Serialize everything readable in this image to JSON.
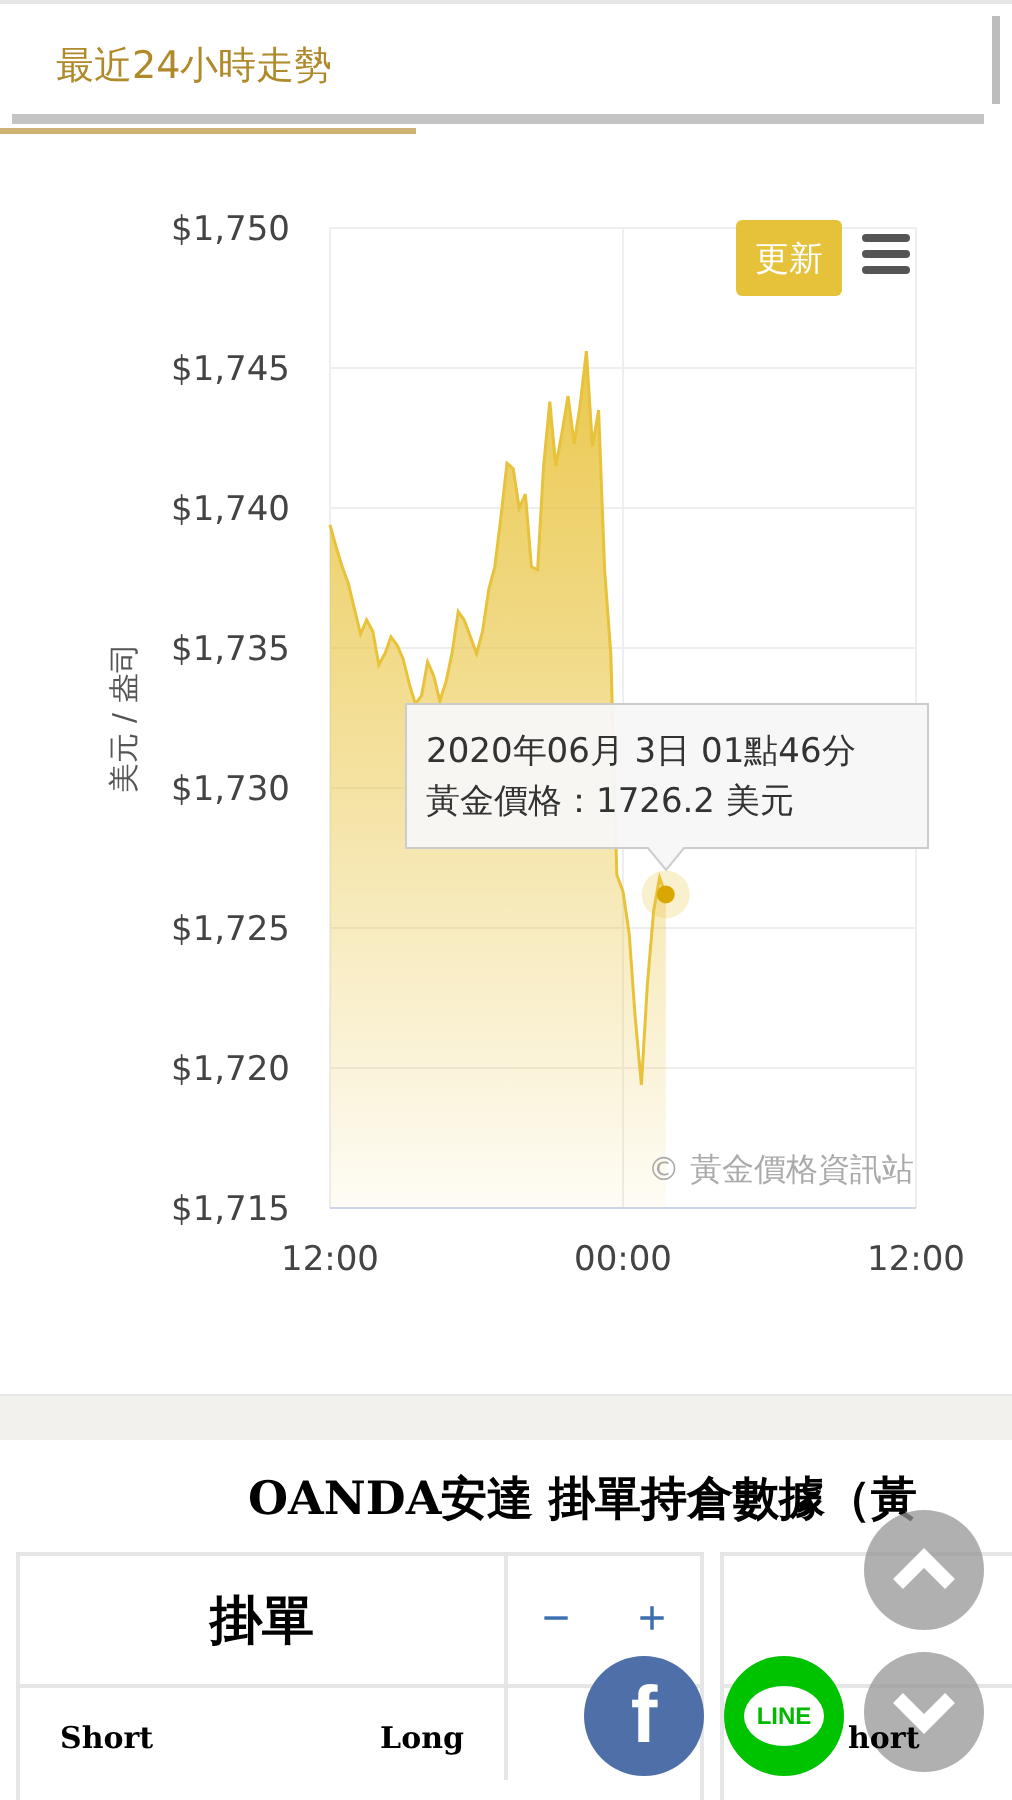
{
  "tabs": [
    {
      "label": "最近24小時走勢",
      "selected": true
    }
  ],
  "chart": {
    "refresh_button": "更新",
    "credit": "© 黃金價格資訊站",
    "tooltip": {
      "lines": [
        "2020年06月 3日 01點46分",
        "黃金價格：1726.2 美元"
      ]
    },
    "chart_data": {
      "type": "area",
      "grid": true,
      "ylabel": "美元 / 盎司",
      "categories": [
        "12:00",
        null,
        null,
        null,
        null,
        null,
        null,
        null,
        null,
        null,
        null,
        null,
        null,
        null,
        null,
        null,
        null,
        null,
        null,
        null,
        null,
        null,
        null,
        null,
        null,
        null,
        null,
        null,
        null,
        null,
        null,
        null,
        null,
        null,
        null,
        null,
        null,
        null,
        null,
        null,
        null,
        null,
        null,
        null,
        null,
        null,
        null,
        null,
        "00:00",
        null,
        null,
        null,
        null,
        null,
        null,
        null,
        null,
        null,
        null,
        null,
        null,
        null,
        null,
        null,
        null,
        null,
        null,
        null,
        null,
        null,
        null,
        null,
        null,
        null,
        null,
        null,
        null,
        null,
        null,
        null,
        null,
        null,
        null,
        null,
        null,
        null,
        null,
        null,
        null,
        null,
        null,
        null,
        null,
        null,
        null,
        null,
        "12:00"
      ],
      "series": [
        {
          "color": "#e8c23a",
          "values": [
            1739.4,
            1738.6,
            1737.9,
            1737.3,
            1736.4,
            1735.5,
            1736.0,
            1735.6,
            1734.4,
            1734.8,
            1735.4,
            1735.1,
            1734.6,
            1733.7,
            1733.0,
            1733.3,
            1734.5,
            1734.0,
            1733.1,
            1733.8,
            1734.8,
            1736.3,
            1736.0,
            1735.4,
            1734.8,
            1735.6,
            1737.1,
            1737.9,
            1739.7,
            1741.6,
            1741.4,
            1740.0,
            1740.5,
            1737.9,
            1737.8,
            1741.5,
            1743.8,
            1741.5,
            1742.7,
            1744.0,
            1742.3,
            1743.7,
            1745.6,
            1742.2,
            1743.5,
            1737.8,
            1734.8,
            1726.9,
            1726.3,
            1724.8,
            1721.8,
            1719.4,
            1723.0,
            1725.6,
            1726.8,
            1726.2,
            null,
            null,
            null,
            null,
            null,
            null,
            null,
            null,
            null,
            null,
            null,
            null,
            null,
            null,
            null,
            null,
            null,
            null,
            null,
            null,
            null,
            null,
            null,
            null,
            null,
            null,
            null,
            null,
            null,
            null,
            null,
            null,
            null,
            null,
            null,
            null,
            null,
            null,
            null,
            null,
            null
          ]
        }
      ],
      "ylim": [
        1715,
        1750
      ],
      "yticks": [
        {
          "value": 1715,
          "label": "$1,715"
        },
        {
          "value": 1720,
          "label": "$1,720"
        },
        {
          "value": 1725,
          "label": "$1,725"
        },
        {
          "value": 1730,
          "label": "$1,730"
        },
        {
          "value": 1735,
          "label": "$1,735"
        },
        {
          "value": 1740,
          "label": "$1,740"
        },
        {
          "value": 1745,
          "label": "$1,745"
        },
        {
          "value": 1750,
          "label": "$1,750"
        }
      ]
    }
  },
  "oanda": {
    "title": "OANDA安達 掛單持倉數據（黃",
    "cards": [
      {
        "title": "掛單",
        "zoom_out": "−",
        "zoom_in": "+",
        "columns": [
          "Short",
          "Long"
        ]
      },
      {
        "columns": [
          "hort"
        ]
      }
    ]
  },
  "social": [
    {
      "kind": "facebook",
      "label": "f"
    },
    {
      "kind": "line",
      "label": "LINE"
    }
  ]
}
